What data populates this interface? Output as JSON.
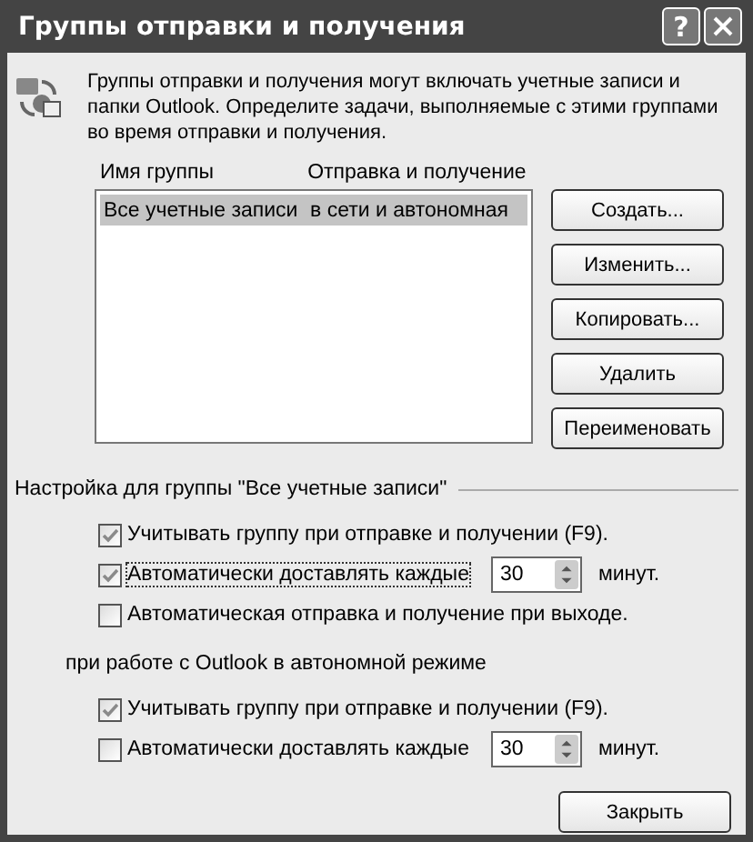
{
  "window": {
    "title": "Группы отправки и получения",
    "help_button": "?"
  },
  "description": "Группы отправки и получения могут включать учетные записи и папки Outlook. Определите задачи, выполняемые с этими группами во время отправки и получения.",
  "groups_list": {
    "columns": [
      "Имя группы",
      "Отправка и получение"
    ],
    "rows": [
      {
        "cells": [
          "Все учетные записи",
          "в сети и автономная"
        ],
        "selected": true
      }
    ]
  },
  "actions": [
    "Создать...",
    "Изменить...",
    "Копировать...",
    "Удалить",
    "Переименовать"
  ],
  "sections": [
    {
      "title": "Настройка для группы \"Все учетные записи\"",
      "options": [
        {
          "kind": "checkbox",
          "label": "Учитывать группу при отправке и получении (F9).",
          "checked": true
        },
        {
          "kind": "interval",
          "label": "Автоматически доставлять каждые",
          "checked": true,
          "value": "30",
          "unit": "минут."
        },
        {
          "kind": "checkbox",
          "label": "Автоматическая отправка и получение при выходе.",
          "checked": false
        }
      ]
    },
    {
      "title": "при работе с Outlook в автономной режиме",
      "options": [
        {
          "kind": "checkbox",
          "label": "Учитывать группу при отправке и получении (F9).",
          "checked": true
        },
        {
          "kind": "interval",
          "label": "Автоматически доставлять каждые",
          "checked": false,
          "value": "30",
          "unit": "минут."
        }
      ]
    }
  ],
  "close_button": "Закрыть"
}
